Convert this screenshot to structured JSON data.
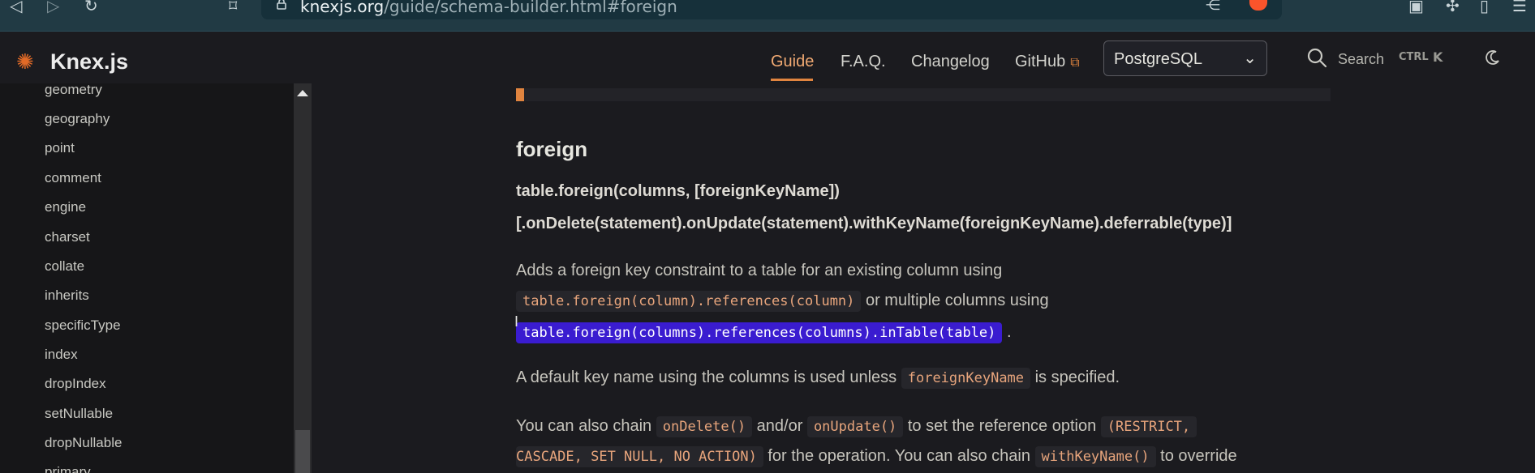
{
  "browser": {
    "url_host": "knexjs.org",
    "url_path": "/guide/schema-builder.html#foreign"
  },
  "site": {
    "title": "Knex.js",
    "nav": {
      "guide": "Guide",
      "faq": "F.A.Q.",
      "changelog": "Changelog",
      "github": "GitHub"
    },
    "dialect_select": "PostgreSQL",
    "search_label": "Search",
    "search_kbd_ctrl": "CTRL",
    "search_kbd_key": "K",
    "accent_color": "#e0843f"
  },
  "sidebar": {
    "items": [
      "geometry",
      "geography",
      "point",
      "comment",
      "engine",
      "charset",
      "collate",
      "inherits",
      "specificType",
      "index",
      "dropIndex",
      "setNullable",
      "dropNullable",
      "primary"
    ]
  },
  "content": {
    "heading": "foreign",
    "signature_line1": "table.foreign(columns, [foreignKeyName])",
    "signature_line2": "[.onDelete(statement).onUpdate(statement).withKeyName(foreignKeyName).deferrable(type)]",
    "p1_text1": "Adds a foreign key constraint to a table for an existing column using",
    "p1_code1": "table.foreign(column).references(column)",
    "p1_text2": "or multiple columns using",
    "p1_code2": "table.foreign(columns).references(columns).inTable(table)",
    "p1_end": ".",
    "p2_text1": "A default key name using the columns is used unless",
    "p2_code1": "foreignKeyName",
    "p2_text2": "is specified.",
    "p3_text1": "You can also chain",
    "p3_code1": "onDelete()",
    "p3_text2": "and/or",
    "p3_code2": "onUpdate()",
    "p3_text3": "to set the reference option",
    "p3_code3": "(RESTRICT,",
    "p3_code4": "CASCADE, SET NULL, NO ACTION)",
    "p3_text4": "for the operation. You can also chain",
    "p3_code5": "withKeyName()",
    "p3_text5": "to override"
  }
}
